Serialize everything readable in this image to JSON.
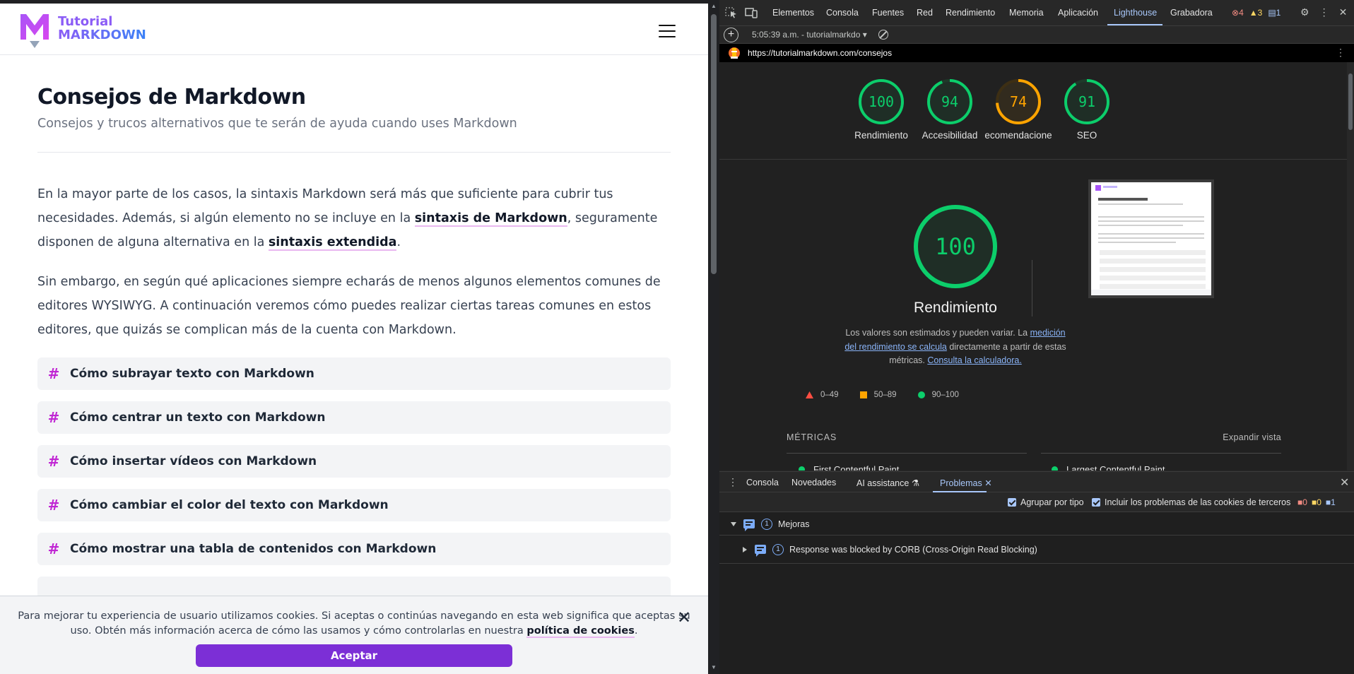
{
  "site": {
    "logo": {
      "line1": "Tutorial",
      "line2": "MARKDOWN"
    },
    "title": "Consejos de Markdown",
    "subtitle": "Consejos y trucos alternativos que te serán de ayuda cuando uses Markdown",
    "intro": {
      "p1_a": "En la mayor parte de los casos, la sintaxis Markdown será más que suficiente para cubrir tus necesidades. Además, si algún elemento no se incluye en la ",
      "p1_link1": "sintaxis de Markdown",
      "p1_b": ", seguramente disponen de alguna alternativa en la ",
      "p1_link2": "sintaxis extendida",
      "p1_c": ".",
      "p2": "Sin embargo, en según qué aplicaciones siempre echarás de menos algunos elementos comunes de editores WYSIWYG. A continuación veremos cómo puedes realizar ciertas tareas comunes en estos editores, que quizás se complican más de la cuenta con Markdown."
    },
    "tips": [
      {
        "label": "Cómo subrayar texto con Markdown"
      },
      {
        "label": "Cómo centrar un texto con Markdown"
      },
      {
        "label": "Cómo insertar vídeos con Markdown"
      },
      {
        "label": "Cómo cambiar el color del texto con Markdown"
      },
      {
        "label": "Cómo mostrar una tabla de contenidos con Markdown"
      }
    ],
    "tip_hash": "#",
    "cookie": {
      "text_a": "Para mejorar tu experiencia de usuario utilizamos cookies. Si aceptas o continúas navegando en esta web significa que aceptas su uso. Obtén más información acerca de cómo las usamos y cómo controlarlas en nuestra ",
      "link": "política de cookies",
      "text_b": ".",
      "close": "✕",
      "accept": "Aceptar"
    }
  },
  "devtools": {
    "tabs": [
      "Elementos",
      "Consola",
      "Fuentes",
      "Red",
      "Rendimiento",
      "Memoria",
      "Aplicación",
      "Lighthouse",
      "Grabadora"
    ],
    "active_tab": "Lighthouse",
    "badges": {
      "errors": "4",
      "warnings": "3",
      "info": "1"
    },
    "toolbar": {
      "report_label": "5:05:39 a.m. - tutorialmarkdo ▾"
    },
    "url": "https://tutorialmarkdown.com/consejos",
    "gauges": [
      {
        "label": "Rendimiento",
        "score": 100,
        "color": "#0cce6b"
      },
      {
        "label": "Accesibilidad",
        "score": 94,
        "color": "#0cce6b"
      },
      {
        "label": "ecomendacione",
        "score": 74,
        "color": "#ffa400"
      },
      {
        "label": "SEO",
        "score": 91,
        "color": "#0cce6b"
      }
    ],
    "big": {
      "score": 100,
      "title": "Rendimiento",
      "desc_a": "Los valores son estimados y pueden variar. La ",
      "desc_link1": "medición del rendimiento se calcula",
      "desc_b": " directamente a partir de estas métricas. ",
      "desc_link2": "Consulta la calculadora."
    },
    "legend": [
      {
        "label": "0–49",
        "color": "#ff4e42",
        "shape": "triangle"
      },
      {
        "label": "50–89",
        "color": "#ffa400",
        "shape": "square"
      },
      {
        "label": "90–100",
        "color": "#0cce6b",
        "shape": "circle"
      }
    ],
    "metrics": {
      "heading": "MÉTRICAS",
      "expand": "Expandir vista",
      "items": [
        "First Contentful Paint",
        "Largest Contentful Paint"
      ]
    },
    "drawer": {
      "tabs": [
        "Consola",
        "Novedades",
        "AI assistance",
        "Problemas"
      ],
      "active": "Problemas",
      "ai_flask": "⚗",
      "close_tab": "✕",
      "close": "✕",
      "kebab": "⋮"
    },
    "issues": {
      "group_by_type": "Agrupar por tipo",
      "third_party": "Incluir los problemas de las cookies de terceros",
      "counts": {
        "errors": "0",
        "warnings": "0",
        "info": "1"
      },
      "group": {
        "count": "1",
        "label": "Mejoras"
      },
      "item": {
        "count": "1",
        "label": "Response was blocked by CORB (Cross-Origin Read Blocking)"
      }
    }
  }
}
